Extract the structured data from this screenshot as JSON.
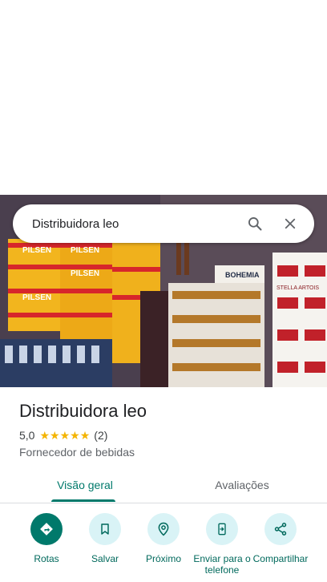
{
  "search": {
    "query": "Distribuidora leo"
  },
  "place": {
    "name": "Distribuidora leo",
    "rating": "5,0",
    "stars": 5,
    "reviews_count": "(2)",
    "category": "Fornecedor de bebidas"
  },
  "photo": {
    "signs": [
      "PILSEN",
      "PILSEN",
      "PILSEN",
      "PILSEN",
      "BOHEMIA",
      "STELLA ARTOIS"
    ]
  },
  "tabs": [
    {
      "label": "Visão geral",
      "active": true
    },
    {
      "label": "Avaliações",
      "active": false
    }
  ],
  "actions": [
    {
      "label": "Rotas",
      "icon": "directions-icon"
    },
    {
      "label": "Salvar",
      "icon": "bookmark-icon"
    },
    {
      "label": "Próximo",
      "icon": "nearby-icon"
    },
    {
      "label": "Enviar para o telefone",
      "icon": "send-to-phone-icon"
    },
    {
      "label": "Compartilhar",
      "icon": "share-icon"
    }
  ],
  "colors": {
    "accent": "#00796b",
    "action_bg": "#d9f3f6",
    "star": "#f4b400",
    "pack_yellow": "#f2b51e",
    "pack_red": "#d7262b"
  }
}
